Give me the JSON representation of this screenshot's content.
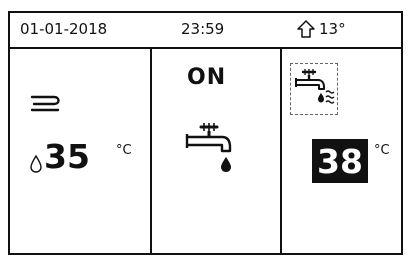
{
  "status_bar": {
    "date": "01-01-2018",
    "time": "23:59",
    "outdoor_temp": "13°"
  },
  "panels": {
    "left": {
      "mode_icon": "room-air-icon",
      "temp_value": "35",
      "temp_unit": "°C"
    },
    "middle": {
      "state": "ON",
      "icon": "hot-water-tap-icon"
    },
    "right": {
      "icon": "tap-heating-icon",
      "temp_value": "38",
      "temp_unit": "°C"
    }
  }
}
